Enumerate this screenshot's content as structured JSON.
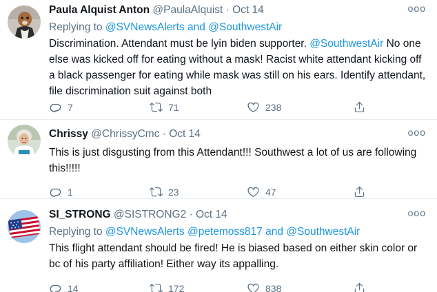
{
  "tweets": [
    {
      "name": "Paula Alquist Anton",
      "handle": "@PaulaAlquist",
      "separator": "·",
      "date": "Oct 14",
      "more": "ooo",
      "reply_prefix": "Replying to",
      "reply_mentions": [
        "@SVNewsAlerts",
        "and",
        "@SouthwestAir"
      ],
      "text_parts": [
        "Discrimination. Attendant must be lyin biden supporter. ",
        "@SouthwestAir",
        " No one else was kicked off for eating without a mask! Racist white attendant kicking off a black passenger for eating while mask was still on his ears. Identify attendant, file discrimination suit against both"
      ],
      "replies": "7",
      "retweets": "71",
      "likes": "238"
    },
    {
      "name": "Chrissy",
      "handle": "@ChrissyCmc",
      "separator": "·",
      "date": "Oct 14",
      "more": "ooo",
      "text": "This is just disgusting from this Attendant!!! Southwest a lot of us are following this!!!!!",
      "replies": "1",
      "retweets": "23",
      "likes": "47"
    },
    {
      "name": "SI_STRONG",
      "handle": "@SISTRONG2",
      "separator": "·",
      "date": "Oct 14",
      "more": "ooo",
      "reply_prefix": "Replying to",
      "reply_mentions": [
        "@SVNewsAlerts",
        "@petemoss817",
        "and",
        "@SouthwestAir"
      ],
      "text": "This flight attendant should be fired! He is biased based on either skin color or bc of his party affiliation! Either way its appalling.",
      "replies": "14",
      "retweets": "172",
      "likes": "838"
    }
  ],
  "icons": {
    "reply": "reply-icon",
    "retweet": "retweet-icon",
    "like": "like-icon",
    "share": "share-icon"
  },
  "colors": {
    "link": "#1b95e0",
    "secondary_text": "#5b7083",
    "divider": "#e6ecf0"
  }
}
